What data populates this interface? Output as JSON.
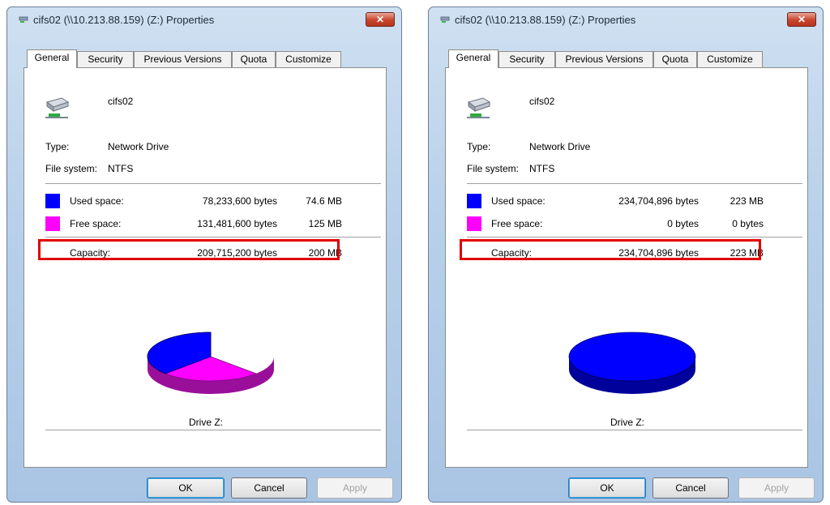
{
  "left": {
    "title": "cifs02 (\\\\10.213.88.159) (Z:) Properties",
    "tabs": [
      "General",
      "Security",
      "Previous Versions",
      "Quota",
      "Customize"
    ],
    "drive_name": "cifs02",
    "type_label": "Type:",
    "type_value": "Network Drive",
    "fs_label": "File system:",
    "fs_value": "NTFS",
    "used_label": "Used space:",
    "used_bytes": "78,233,600 bytes",
    "used_size": "74.6 MB",
    "free_label": "Free space:",
    "free_bytes": "131,481,600 bytes",
    "free_size": "125 MB",
    "capacity_label": "Capacity:",
    "capacity_bytes": "209,715,200 bytes",
    "capacity_size": "200 MB",
    "used_fraction": 0.373,
    "drive_caption": "Drive Z:",
    "ok": "OK",
    "cancel": "Cancel",
    "apply": "Apply"
  },
  "right": {
    "title": "cifs02 (\\\\10.213.88.159) (Z:) Properties",
    "tabs": [
      "General",
      "Security",
      "Previous Versions",
      "Quota",
      "Customize"
    ],
    "drive_name": "cifs02",
    "type_label": "Type:",
    "type_value": "Network Drive",
    "fs_label": "File system:",
    "fs_value": "NTFS",
    "used_label": "Used space:",
    "used_bytes": "234,704,896 bytes",
    "used_size": "223 MB",
    "free_label": "Free space:",
    "free_bytes": "0 bytes",
    "free_size": "0 bytes",
    "capacity_label": "Capacity:",
    "capacity_bytes": "234,704,896 bytes",
    "capacity_size": "223 MB",
    "used_fraction": 1.0,
    "drive_caption": "Drive Z:",
    "ok": "OK",
    "cancel": "Cancel",
    "apply": "Apply"
  },
  "colors": {
    "used": "#0000ff",
    "used_dark": "#00009a",
    "free": "#ff00ff",
    "free_dark": "#9a0f9a",
    "highlight": "#e00000"
  },
  "icons": {
    "title": "network-drive-icon",
    "drive": "network-drive-icon"
  }
}
